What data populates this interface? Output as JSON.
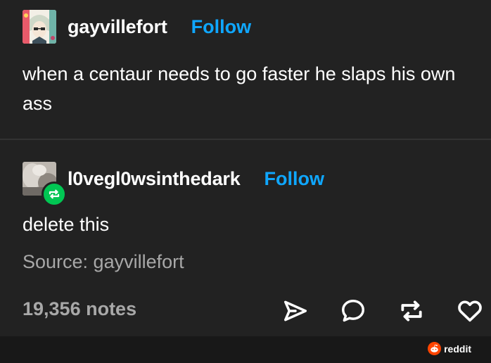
{
  "original_post": {
    "username": "gayvillefort",
    "follow_label": "Follow",
    "body_line_1": "when a centaur needs to go faster he slaps his own",
    "body_line_2": "ass"
  },
  "reblog": {
    "username": "l0vegl0wsinthedark",
    "follow_label": "Follow",
    "body": "delete this",
    "source": "Source: gayvillefort",
    "badge_icon": "reblog-icon"
  },
  "footer_bar": {
    "notes": "19,356 notes",
    "actions": [
      "share-icon",
      "reply-icon",
      "reblog-icon",
      "like-icon"
    ]
  },
  "watermark": {
    "text": "reddit",
    "color": "#ff4500"
  },
  "colors": {
    "background": "#222222",
    "follow": "#0fa7ff",
    "muted": "#a8a8a8",
    "reblog_green": "#01c653"
  }
}
